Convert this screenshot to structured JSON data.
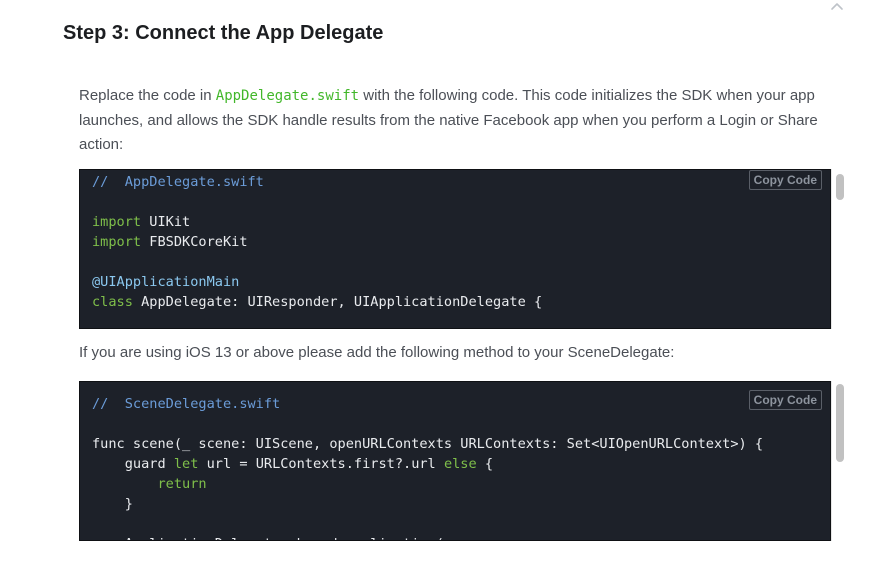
{
  "step": {
    "title": "Step 3: Connect the App Delegate"
  },
  "intro": {
    "before": "Replace the code in ",
    "file": "AppDelegate.swift",
    "after": " with the following code. This code initializes the SDK when your app launches, and allows the SDK handle results from the native Facebook app when you perform a Login or Share action:"
  },
  "code_block_1": {
    "copy_label": "Copy Code",
    "lines": [
      [
        {
          "t": "//  AppDelegate.swift",
          "c": "comment"
        }
      ],
      [],
      [
        {
          "t": "import",
          "c": "keyword"
        },
        {
          "t": " UIKit",
          "c": "plain"
        }
      ],
      [
        {
          "t": "import",
          "c": "keyword"
        },
        {
          "t": " FBSDKCoreKit",
          "c": "plain"
        }
      ],
      [],
      [
        {
          "t": "@UIApplicationMain",
          "c": "attr"
        }
      ],
      [
        {
          "t": "class",
          "c": "keyword"
        },
        {
          "t": " AppDelegate: UIResponder, UIApplicationDelegate {",
          "c": "plain"
        }
      ]
    ]
  },
  "ios13_note": "If you are using iOS 13 or above please add the following method to your SceneDelegate:",
  "code_block_2": {
    "copy_label": "Copy Code",
    "lines": [
      [
        {
          "t": "//  SceneDelegate.swift",
          "c": "comment"
        }
      ],
      [],
      [
        {
          "t": "func scene(_ scene: UIScene, openURLContexts URLContexts: Set<UIOpenURLContext>) {",
          "c": "plain"
        }
      ],
      [
        {
          "t": "    guard ",
          "c": "plain"
        },
        {
          "t": "let",
          "c": "keyword"
        },
        {
          "t": " url = URLContexts.first?.url ",
          "c": "plain"
        },
        {
          "t": "else",
          "c": "keyword"
        },
        {
          "t": " {",
          "c": "plain"
        }
      ],
      [
        {
          "t": "        return",
          "c": "keyword"
        }
      ],
      [
        {
          "t": "    }",
          "c": "plain"
        }
      ],
      [],
      [
        {
          "t": "    ApplicationDelegate.shared.application(",
          "c": "plain"
        }
      ]
    ]
  },
  "icons": {
    "collapse": "chevron-up-icon"
  }
}
